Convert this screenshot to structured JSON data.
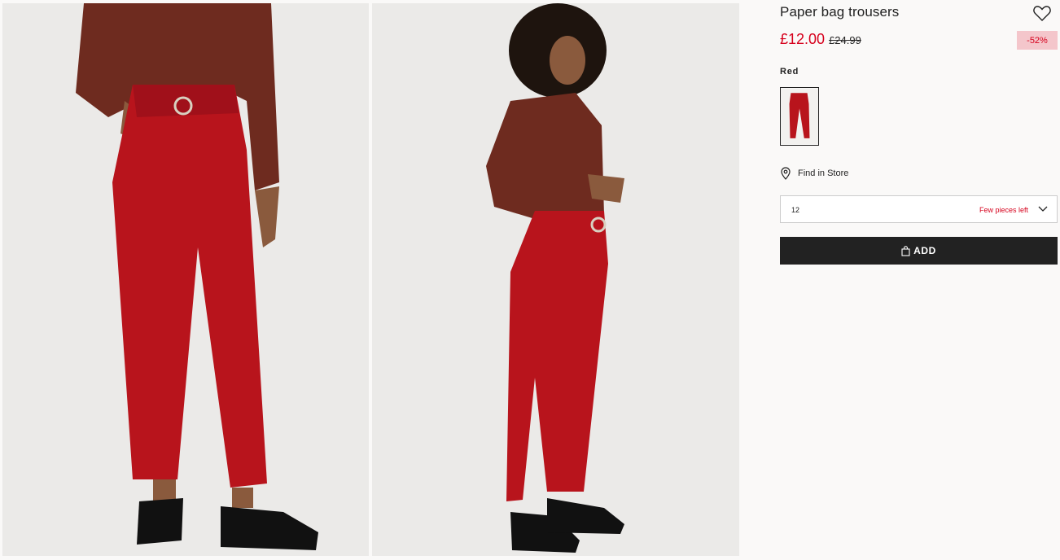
{
  "product": {
    "title": "Paper bag trousers",
    "price_now": "£12.00",
    "price_old": "£24.99",
    "discount": "-52%",
    "color_name": "Red",
    "find_in_store": "Find in Store",
    "size": {
      "value": "12",
      "stock_note": "Few pieces left"
    },
    "add_label": "ADD"
  },
  "icons": {
    "favourite": "heart-outline-icon",
    "store": "location-pin-icon",
    "dropdown": "chevron-down-icon",
    "bag": "shopping-bag-icon"
  },
  "colors": {
    "accent_red": "#d6001c",
    "discount_bg": "#f4c6cb",
    "button_bg": "#222222",
    "trousers": "#b8141c",
    "sweater": "#6e2b1f"
  }
}
